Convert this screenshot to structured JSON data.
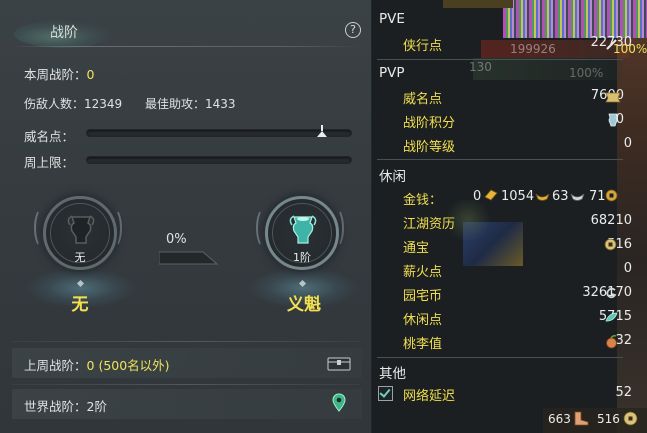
{
  "left": {
    "title": "战阶",
    "help_icon": "?",
    "weekly_label": "本周战阶：",
    "weekly_value": "0",
    "kills_label": "伤敌人数：",
    "kills_value": "12349",
    "assist_label": "最佳助攻：",
    "assist_value": "1433",
    "prestige_label": "威名点：",
    "prestige_progress": 0.89,
    "weekcap_label": "周上限：",
    "weekcap_progress": 0.0,
    "progress_percent": "0%",
    "current_rank_sub": "无",
    "current_rank_name": "无",
    "next_rank_sub": "1阶",
    "next_rank_name": "义魁",
    "last_week_label": "上周战阶：",
    "last_week_value": "0 (500名以外)",
    "world_label": "世界战阶：",
    "world_value": "2阶",
    "colors": {
      "accent": "#f0e35a",
      "badge_teal": "#3fb3a6"
    }
  },
  "right": {
    "pve": {
      "title": "PVE",
      "rows": [
        {
          "label": "侠行点",
          "value": "22730"
        }
      ],
      "overlay_text_1": "199926",
      "overlay_text_2": "100%"
    },
    "pvp": {
      "title": "PVP",
      "rows": [
        {
          "label": "威名点",
          "value": "7600"
        },
        {
          "label": "战阶积分",
          "value": "0"
        },
        {
          "label": "战阶等级",
          "value": "0"
        }
      ],
      "overlay_text_1": "130",
      "overlay_text_2": "100%"
    },
    "leisure": {
      "title": "休闲",
      "money_label": "金钱：",
      "money_gold": "0",
      "money_ingot": "1054",
      "money_silver": "63",
      "money_copper": "71",
      "rows": [
        {
          "label": "江湖资历",
          "value": "68210"
        },
        {
          "label": "通宝",
          "value": "516"
        },
        {
          "label": "薪火点",
          "value": "0"
        },
        {
          "label": "园宅币",
          "value": "326170"
        },
        {
          "label": "休闲点",
          "value": "5715"
        },
        {
          "label": "桃李值",
          "value": "32"
        }
      ]
    },
    "other": {
      "title": "其他",
      "latency_label": "网络延迟",
      "latency_value": "52"
    },
    "footer": {
      "val1": "663",
      "val2": "516"
    }
  }
}
